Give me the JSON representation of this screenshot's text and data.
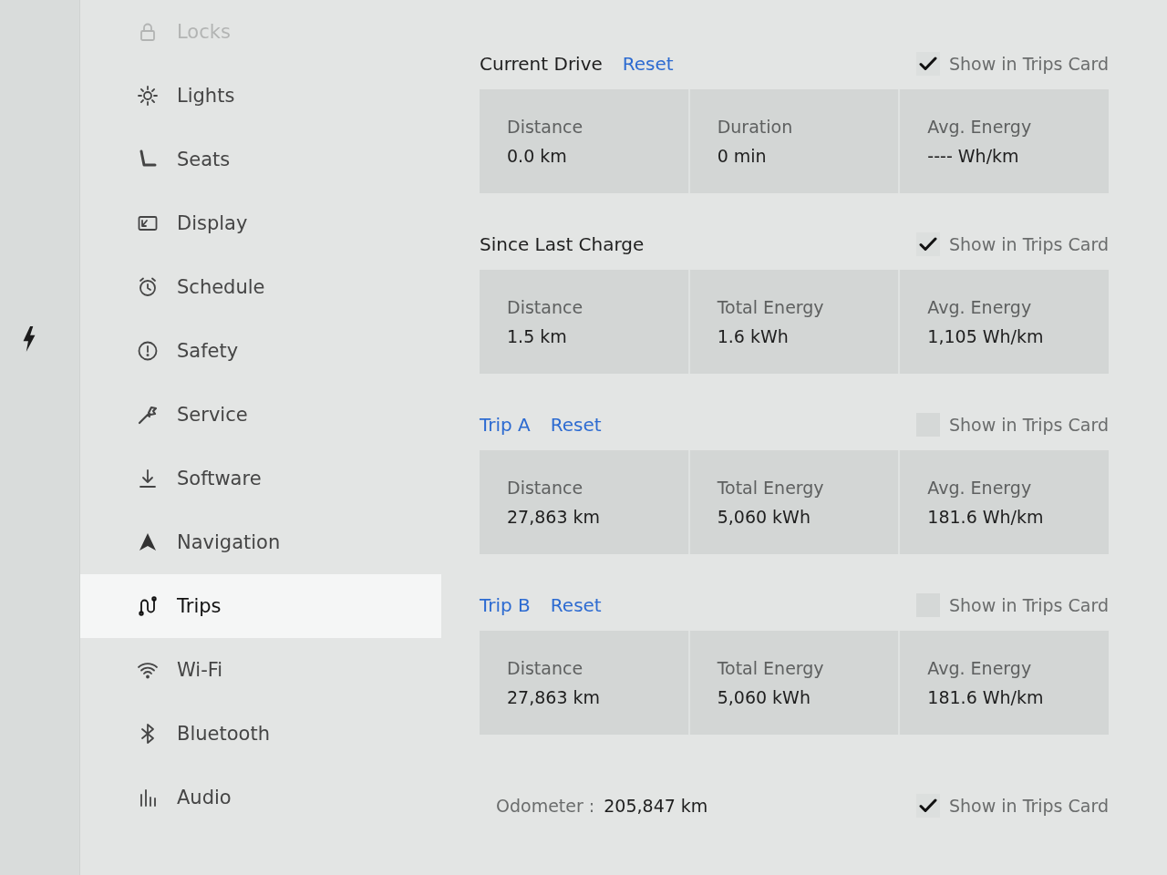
{
  "sidebar": {
    "items": [
      {
        "label": "Locks",
        "dimmed": true,
        "selected": false
      },
      {
        "label": "Lights",
        "dimmed": false,
        "selected": false
      },
      {
        "label": "Seats",
        "dimmed": false,
        "selected": false
      },
      {
        "label": "Display",
        "dimmed": false,
        "selected": false
      },
      {
        "label": "Schedule",
        "dimmed": false,
        "selected": false
      },
      {
        "label": "Safety",
        "dimmed": false,
        "selected": false
      },
      {
        "label": "Service",
        "dimmed": false,
        "selected": false
      },
      {
        "label": "Software",
        "dimmed": false,
        "selected": false
      },
      {
        "label": "Navigation",
        "dimmed": false,
        "selected": false
      },
      {
        "label": "Trips",
        "dimmed": false,
        "selected": true
      },
      {
        "label": "Wi-Fi",
        "dimmed": false,
        "selected": false
      },
      {
        "label": "Bluetooth",
        "dimmed": false,
        "selected": false
      },
      {
        "label": "Audio",
        "dimmed": false,
        "selected": false
      }
    ]
  },
  "sections": [
    {
      "title": "Current Drive",
      "title_link": false,
      "reset": "Reset",
      "show_in_trips_card": {
        "label": "Show in Trips Card",
        "checked": true
      },
      "stats": [
        {
          "label": "Distance",
          "value": "0.0 km"
        },
        {
          "label": "Duration",
          "value": "0 min"
        },
        {
          "label": "Avg. Energy",
          "value": "---- Wh/km"
        }
      ]
    },
    {
      "title": "Since Last Charge",
      "title_link": false,
      "show_in_trips_card": {
        "label": "Show in Trips Card",
        "checked": true
      },
      "stats": [
        {
          "label": "Distance",
          "value": "1.5 km"
        },
        {
          "label": "Total Energy",
          "value": "1.6 kWh"
        },
        {
          "label": "Avg. Energy",
          "value": "1,105 Wh/km"
        }
      ]
    },
    {
      "title": "Trip A",
      "title_link": true,
      "reset": "Reset",
      "show_in_trips_card": {
        "label": "Show in Trips Card",
        "checked": false
      },
      "stats": [
        {
          "label": "Distance",
          "value": "27,863 km"
        },
        {
          "label": "Total Energy",
          "value": "5,060 kWh"
        },
        {
          "label": "Avg. Energy",
          "value": "181.6 Wh/km"
        }
      ]
    },
    {
      "title": "Trip B",
      "title_link": true,
      "reset": "Reset",
      "show_in_trips_card": {
        "label": "Show in Trips Card",
        "checked": false
      },
      "stats": [
        {
          "label": "Distance",
          "value": "27,863 km"
        },
        {
          "label": "Total Energy",
          "value": "5,060 kWh"
        },
        {
          "label": "Avg. Energy",
          "value": "181.6 Wh/km"
        }
      ]
    }
  ],
  "odometer": {
    "label": "Odometer :",
    "value": "205,847 km",
    "show_in_trips_card": {
      "label": "Show in Trips Card",
      "checked": true
    }
  }
}
